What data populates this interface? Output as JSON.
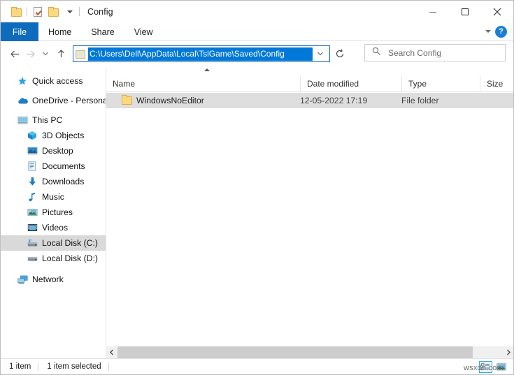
{
  "window": {
    "title": "Config",
    "quick_access": [
      {
        "name": "folder-icon",
        "label": "Folder"
      },
      {
        "name": "properties-icon",
        "label": "Properties"
      },
      {
        "name": "new-folder-icon",
        "label": "New folder"
      },
      {
        "name": "customize-caret-icon",
        "label": "Customize Quick Access Toolbar"
      }
    ],
    "controls": {
      "minimize": "Minimize",
      "maximize": "Maximize",
      "close": "Close"
    }
  },
  "ribbon": {
    "tabs": [
      {
        "label": "File",
        "active": true
      },
      {
        "label": "Home",
        "active": false
      },
      {
        "label": "Share",
        "active": false
      },
      {
        "label": "View",
        "active": false
      }
    ],
    "expand_label": "Expand the Ribbon",
    "help_label": "?"
  },
  "navigation": {
    "back": "Back",
    "forward": "Forward",
    "recent": "Recent locations",
    "up": "Up",
    "refresh": "Refresh",
    "address_value": "C:\\Users\\Dell\\AppData\\Local\\TslGame\\Saved\\Config",
    "address_dropdown": "Previous locations"
  },
  "search": {
    "placeholder": "Search Config",
    "icon": "search-icon"
  },
  "sidebar": {
    "items": [
      {
        "label": "Quick access",
        "icon": "star-icon",
        "level": 0,
        "selected": false
      },
      {
        "label": "OneDrive - Persona",
        "icon": "cloud-icon",
        "level": 0,
        "selected": false
      },
      {
        "label": "This PC",
        "icon": "monitor-icon",
        "level": 0,
        "selected": false
      },
      {
        "label": "3D Objects",
        "icon": "cube-icon",
        "level": 1,
        "selected": false
      },
      {
        "label": "Desktop",
        "icon": "desktop-icon",
        "level": 1,
        "selected": false
      },
      {
        "label": "Documents",
        "icon": "document-icon",
        "level": 1,
        "selected": false
      },
      {
        "label": "Downloads",
        "icon": "download-arrow-icon",
        "level": 1,
        "selected": false
      },
      {
        "label": "Music",
        "icon": "music-note-icon",
        "level": 1,
        "selected": false
      },
      {
        "label": "Pictures",
        "icon": "picture-icon",
        "level": 1,
        "selected": false
      },
      {
        "label": "Videos",
        "icon": "video-icon",
        "level": 1,
        "selected": false
      },
      {
        "label": "Local Disk (C:)",
        "icon": "system-drive-icon",
        "level": 1,
        "selected": true
      },
      {
        "label": "Local Disk (D:)",
        "icon": "drive-icon",
        "level": 1,
        "selected": false
      },
      {
        "label": "Network",
        "icon": "network-icon",
        "level": 0,
        "selected": false
      }
    ]
  },
  "filelist": {
    "sort_column": "Name",
    "sort_direction": "ascending",
    "columns": [
      {
        "label": "Name"
      },
      {
        "label": "Date modified"
      },
      {
        "label": "Type"
      },
      {
        "label": "Size"
      }
    ],
    "rows": [
      {
        "name": "WindowsNoEditor",
        "date_modified": "12-05-2022 17:19",
        "type": "File folder",
        "size": "",
        "icon": "folder-icon",
        "selected": true
      }
    ]
  },
  "scrollbar": {
    "left_arrow": "Scroll left",
    "right_arrow": "Scroll right"
  },
  "statusbar": {
    "item_count": "1 item",
    "selection": "1 item selected",
    "view_details": "Details view",
    "view_large_icons": "Large icons view"
  },
  "watermark": {
    "text": "wsxdn.com"
  },
  "colors": {
    "accent": "#0f6cbd",
    "selection": "#0078d7",
    "row_selected": "#dedede",
    "nav_selected": "#d9d9d9"
  }
}
